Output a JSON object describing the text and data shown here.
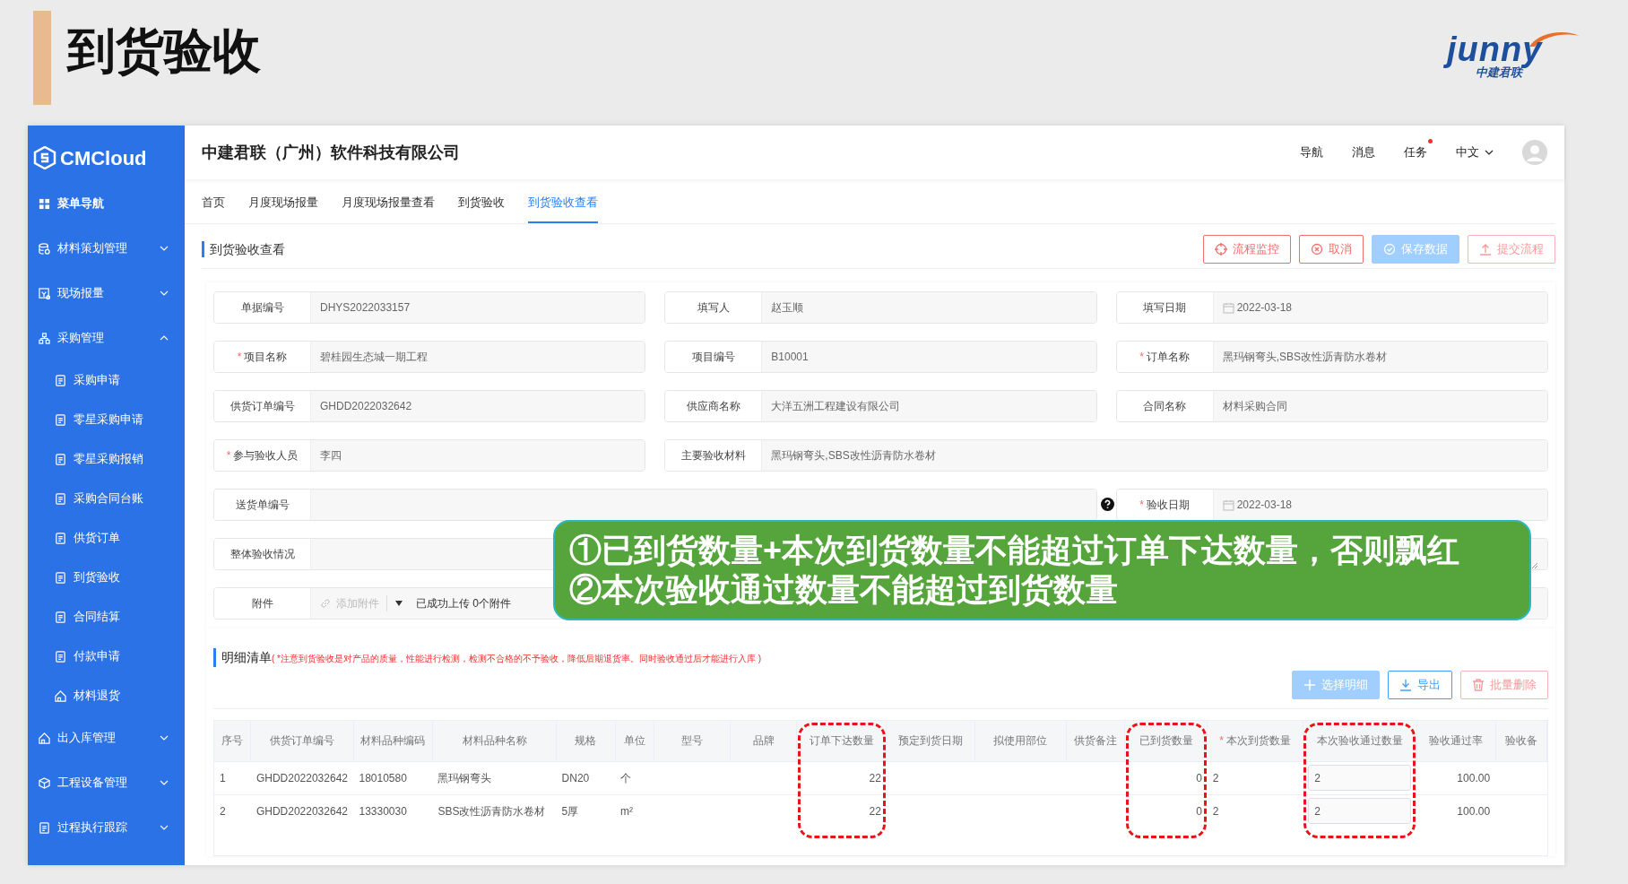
{
  "slide": {
    "title": "到货验收",
    "logo_text": "junny",
    "logo_subtitle": "中建君联"
  },
  "app": {
    "brand": "CMCloud",
    "company": "中建君联（广州）软件科技有限公司",
    "top_links": [
      {
        "label": "导航",
        "dot": false,
        "kind": "link"
      },
      {
        "label": "消息",
        "dot": false,
        "kind": "link"
      },
      {
        "label": "任务",
        "dot": true,
        "kind": "link"
      },
      {
        "label": "中文",
        "dot": false,
        "kind": "dropdown"
      }
    ]
  },
  "sidebar": {
    "items": [
      {
        "label": "菜单导航"
      },
      {
        "label": "材料策划管理",
        "expanded": false
      },
      {
        "label": "现场报量",
        "expanded": false
      },
      {
        "label": "采购管理",
        "expanded": true,
        "children": [
          {
            "label": "采购申请"
          },
          {
            "label": "零星采购申请"
          },
          {
            "label": "零星采购报销"
          },
          {
            "label": "采购合同台账"
          },
          {
            "label": "供货订单"
          },
          {
            "label": "到货验收"
          },
          {
            "label": "合同结算"
          },
          {
            "label": "付款申请"
          },
          {
            "label": "材料退货"
          }
        ]
      },
      {
        "label": "出入库管理",
        "expanded": false
      },
      {
        "label": "工程设备管理",
        "expanded": false
      },
      {
        "label": "过程执行跟踪",
        "expanded": false
      }
    ]
  },
  "tabs": [
    {
      "label": "首页",
      "selected": false
    },
    {
      "label": "月度现场报量",
      "selected": false
    },
    {
      "label": "月度现场报量查看",
      "selected": false
    },
    {
      "label": "到货验收",
      "selected": false
    },
    {
      "label": "到货验收查看",
      "selected": true
    }
  ],
  "page_title": "到货验收查看",
  "actions": [
    {
      "label": "流程监控",
      "disabled": false
    },
    {
      "label": "取消",
      "disabled": false
    },
    {
      "label": "保存数据",
      "disabled": true
    },
    {
      "label": "提交流程",
      "disabled": true
    }
  ],
  "form": {
    "rows": [
      [
        {
          "label": "单据编号",
          "value": "DHYS2022033157",
          "kind": "text"
        },
        {
          "label": "填写人",
          "value": "赵玉顺",
          "kind": "text"
        },
        {
          "label": "填写日期",
          "value": "2022-03-18",
          "kind": "date"
        }
      ],
      [
        {
          "mark": "*",
          "label": "项目名称",
          "value": "碧桂园生态城一期工程",
          "kind": "text"
        },
        {
          "label": "项目编号",
          "value": "B10001",
          "kind": "text"
        },
        {
          "mark": "*",
          "label": "订单名称",
          "value": "黑玛钢弯头,SBS改性沥青防水卷材",
          "kind": "text"
        }
      ],
      [
        {
          "label": "供货订单编号",
          "value": "GHDD2022032642",
          "kind": "text"
        },
        {
          "label": "供应商名称",
          "value": "大洋五洲工程建设有限公司",
          "kind": "text"
        },
        {
          "label": "合同名称",
          "value": "材料采购合同",
          "kind": "text"
        }
      ],
      [
        {
          "mark": "*",
          "label": "参与验收人员",
          "value": "李四",
          "kind": "text"
        },
        {
          "label": "主要验收材料",
          "value": "黑玛钢弯头,SBS改性沥青防水卷材",
          "kind": "text",
          "colspan": 2
        }
      ],
      [
        {
          "label": "送货单编号",
          "kind": "text",
          "colspan": 2,
          "help": true
        },
        {
          "mark": "*",
          "label": "验收日期",
          "value": "2022-03-18",
          "kind": "date"
        }
      ],
      [
        {
          "label": "整体验收情况",
          "kind": "textarea",
          "colspan": 3
        }
      ],
      [
        {
          "label": "附件",
          "kind": "attachment",
          "colspan": 3,
          "button": "添加附件",
          "status": "已成功上传 0个附件"
        }
      ]
    ]
  },
  "detail": {
    "title": "明细清单",
    "note": "( *注意到货验收是对产品的质量，性能进行检测，检测不合格的不予验收，降低后期退货率。同时验收通过后才能进行入库 )",
    "buttons": [
      {
        "label": "选择明细",
        "disabled": true
      },
      {
        "label": "导出",
        "disabled": false
      },
      {
        "label": "批量删除",
        "disabled": true
      }
    ],
    "columns": [
      {
        "label": "序号",
        "kind": "text",
        "highlighted": false
      },
      {
        "label": "供货订单编号",
        "kind": "text",
        "highlighted": false
      },
      {
        "label": "材料品种编码",
        "kind": "text",
        "highlighted": false
      },
      {
        "label": "材料品种名称",
        "kind": "text",
        "highlighted": false
      },
      {
        "label": "规格",
        "kind": "text",
        "highlighted": false
      },
      {
        "label": "单位",
        "kind": "text",
        "highlighted": false
      },
      {
        "label": "型号",
        "kind": "text",
        "highlighted": false
      },
      {
        "label": "品牌",
        "kind": "text",
        "highlighted": false
      },
      {
        "label": "订单下达数量",
        "kind": "number",
        "highlighted": true
      },
      {
        "label": "预定到货日期",
        "kind": "text",
        "highlighted": false
      },
      {
        "label": "拟使用部位",
        "kind": "text",
        "highlighted": false
      },
      {
        "label": "供货备注",
        "kind": "text",
        "highlighted": false
      },
      {
        "label": "已到货数量",
        "kind": "number",
        "highlighted": true
      },
      {
        "mark": "*",
        "label": "本次到货数量",
        "kind": "text",
        "highlighted": false
      },
      {
        "label": "本次验收通过数量",
        "kind": "input",
        "highlighted": true
      },
      {
        "label": "验收通过率",
        "kind": "number",
        "highlighted": false
      },
      {
        "label": "验收备",
        "kind": "text",
        "highlighted": false
      }
    ],
    "rows": [
      [
        "1",
        "GHDD2022032642",
        "18010580",
        "黑玛钢弯头",
        "DN20",
        "个",
        null,
        null,
        "22",
        null,
        null,
        null,
        "0",
        "2",
        "2",
        "100.00",
        null
      ],
      [
        "2",
        "GHDD2022032642",
        "13330030",
        "SBS改性沥青防水卷材",
        "5厚",
        "m²",
        null,
        null,
        "22",
        null,
        null,
        null,
        "0",
        "2",
        "2",
        "100.00",
        null
      ]
    ]
  },
  "callout": {
    "lines": [
      "①已到货数量+本次到货数量不能超过订单下达数量，否则飘红",
      "②本次验收通过数量不能超过到货数量"
    ]
  }
}
